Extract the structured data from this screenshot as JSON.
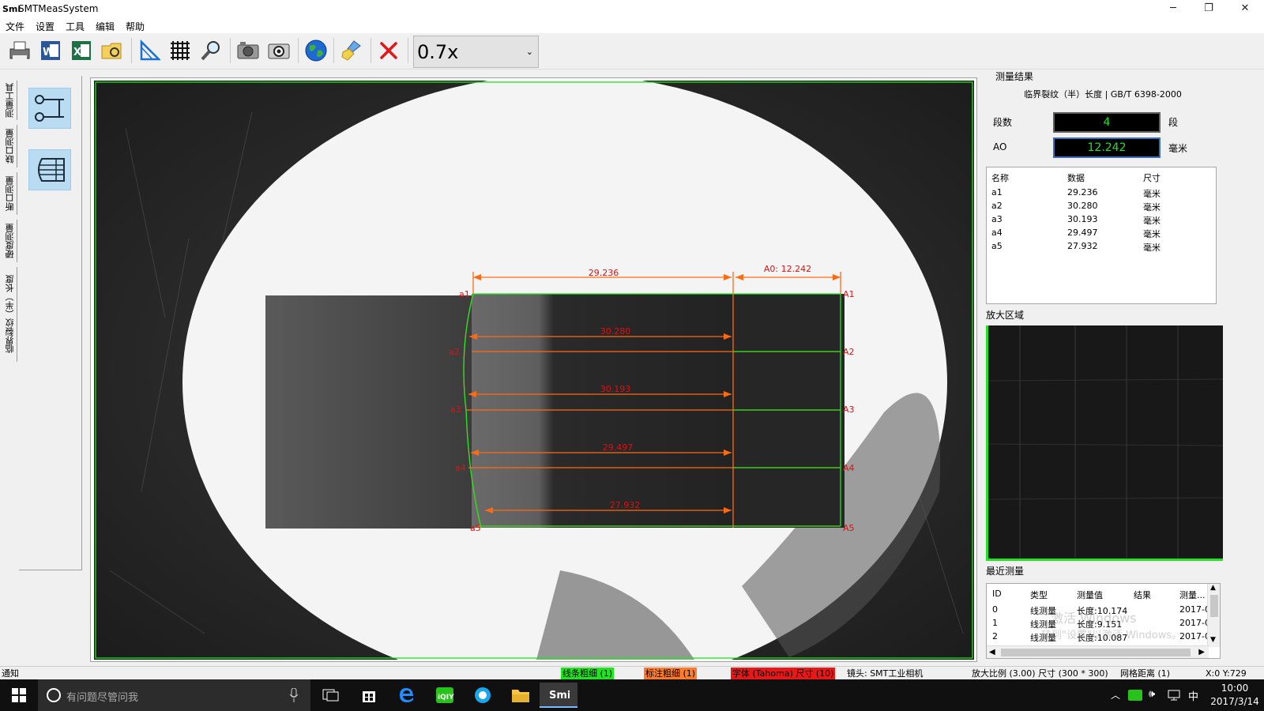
{
  "window": {
    "title": "SMTMeasSystem",
    "logo": "Smi",
    "min": "─",
    "max": "❐",
    "close": "✕"
  },
  "menu": [
    "文件",
    "设置",
    "工具",
    "编辑",
    "帮助"
  ],
  "toolbar": {
    "zoom": "0.7x"
  },
  "left_tabs": [
    "测量工具",
    "缺口测量",
    "断口测量",
    "硬度测量",
    "临界裂纹（半）长度"
  ],
  "image": {
    "top_label_a": "29.236",
    "top_label_b": "A0: 12.242",
    "segments": [
      {
        "left": "a1",
        "right": "A1",
        "value": ""
      },
      {
        "left": "a2",
        "right": "A2",
        "value": "30.280"
      },
      {
        "left": "a3",
        "right": "A3",
        "value": "30.193"
      },
      {
        "left": "a4",
        "right": "A4",
        "value": "29.497"
      },
      {
        "left": "a5",
        "right": "A5",
        "value": "27.932"
      }
    ]
  },
  "results": {
    "title": "测量结果",
    "standard": "临界裂纹（半）长度 | GB/T 6398-2000",
    "segments_label": "段数",
    "segments_value": "4",
    "segments_unit": "段",
    "ao_label": "AO",
    "ao_value": "12.242",
    "ao_unit": "毫米",
    "table_headers": [
      "名称",
      "数据",
      "尺寸"
    ],
    "rows": [
      {
        "name": "a1",
        "value": "29.236",
        "unit": "毫米"
      },
      {
        "name": "a2",
        "value": "30.280",
        "unit": "毫米"
      },
      {
        "name": "a3",
        "value": "30.193",
        "unit": "毫米"
      },
      {
        "name": "a4",
        "value": "29.497",
        "unit": "毫米"
      },
      {
        "name": "a5",
        "value": "27.932",
        "unit": "毫米"
      }
    ]
  },
  "zoom_area": {
    "title": "放大区域"
  },
  "recent": {
    "title": "最近测量",
    "headers": [
      "ID",
      "类型",
      "测量值",
      "结果",
      "测量..."
    ],
    "rows": [
      {
        "id": "0",
        "type": "线测量",
        "value": "长度:10.174",
        "result": "",
        "time": "2017-0"
      },
      {
        "id": "1",
        "type": "线测量",
        "value": "长度:9.151",
        "result": "",
        "time": "2017-0"
      },
      {
        "id": "2",
        "type": "线测量",
        "value": "长度:10.087",
        "result": "",
        "time": "2017-0"
      }
    ],
    "watermark_1": "激活 Windows",
    "watermark_2": "转到\"设置\"以激活 Windows。"
  },
  "status": {
    "notice": "通知",
    "line_width": "线条粗细 (1)",
    "label_width": "标注粗细 (1)",
    "font": "字体 (Tahoma) 尺寸 (10)",
    "camera": "镜头: SMT工业相机",
    "scale": "放大比例 (3.00) 尺寸 (300 * 300)",
    "grid": "网格距离 (1)",
    "coords": "X:0 Y:729"
  },
  "taskbar": {
    "search": "有问题尽管问我",
    "time": "10:00",
    "date": "2017/3/14",
    "ime": "中"
  },
  "colors": {
    "measure": "#ff6a13",
    "label": "#e01010",
    "green": "#22e322"
  }
}
